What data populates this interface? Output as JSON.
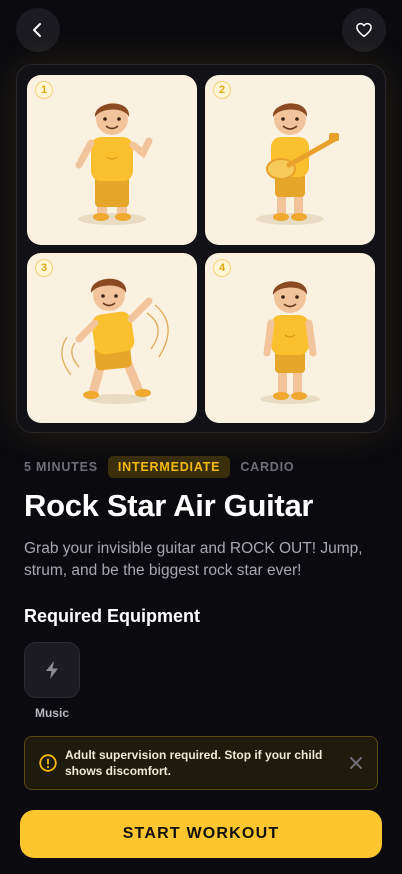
{
  "header": {
    "back_icon": "chevron-left-icon",
    "favorite_icon": "heart-icon"
  },
  "gallery": {
    "steps": [
      {
        "number": "1"
      },
      {
        "number": "2"
      },
      {
        "number": "3"
      },
      {
        "number": "4"
      }
    ]
  },
  "meta": {
    "duration": "5 MINUTES",
    "level": "INTERMEDIATE",
    "category": "CARDIO"
  },
  "workout": {
    "title": "Rock Star Air Guitar",
    "description": "Grab your invisible guitar and ROCK OUT! Jump, strum, and be the biggest rock star ever!"
  },
  "equipment": {
    "heading": "Required Equipment",
    "items": [
      {
        "label": "Music",
        "icon": "lightning-icon"
      }
    ]
  },
  "warning": {
    "text": "Adult supervision required. Stop if your child shows discomfort.",
    "icon": "alert-circle-icon",
    "close_icon": "close-icon"
  },
  "cta": {
    "label": "START WORKOUT"
  },
  "colors": {
    "accent": "#fdc52e",
    "background": "#0a0a0f",
    "card": "#1b1b21",
    "warning_bg": "#1e1a0c"
  }
}
